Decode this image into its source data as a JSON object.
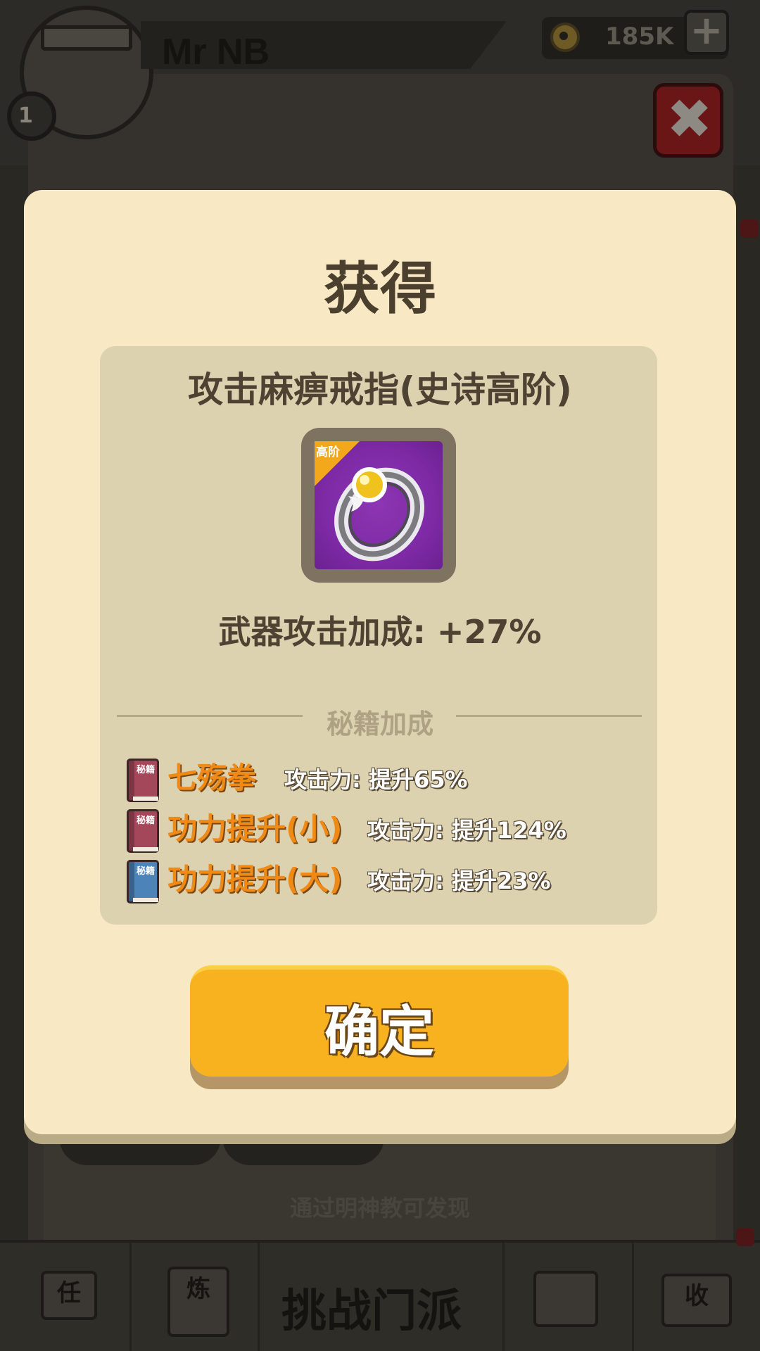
{
  "background": {
    "player_level": "1",
    "player_name": "Mr NB",
    "coins": "185K",
    "add_label": "+",
    "hint_text": "通过明神教可发现",
    "nav": {
      "tab_task_label": "任",
      "tab_refine_label": "炼",
      "challenge_label": "挑战门派",
      "tab_collect_label": "收"
    }
  },
  "close_button": {
    "icon": "close-x-icon",
    "glyph": "✖"
  },
  "modal": {
    "title": "获得",
    "item": {
      "name": "攻击麻痹戒指(史诗高阶)",
      "tier_tag": "高阶",
      "icon": "ring-icon",
      "stat": "武器攻击加成: +27%"
    },
    "section_heading": "秘籍加成",
    "bonuses": [
      {
        "book_label": "秘籍",
        "book_color": "#a4475a",
        "name": "七殇拳",
        "effect": "攻击力: 提升65%"
      },
      {
        "book_label": "秘籍",
        "book_color": "#a4475a",
        "name": "功力提升(小)",
        "effect": "攻击力: 提升124%"
      },
      {
        "book_label": "秘籍",
        "book_color": "#4c83b8",
        "name": "功力提升(大)",
        "effect": "攻击力: 提升23%"
      }
    ],
    "confirm_label": "确定"
  },
  "colors": {
    "modal_bg": "#f8e8c4",
    "panel_bg": "#ddd2b0",
    "accent_orange": "#f08a16",
    "confirm_yellow": "#f8b11f",
    "item_purple": "#7e2aa6"
  }
}
